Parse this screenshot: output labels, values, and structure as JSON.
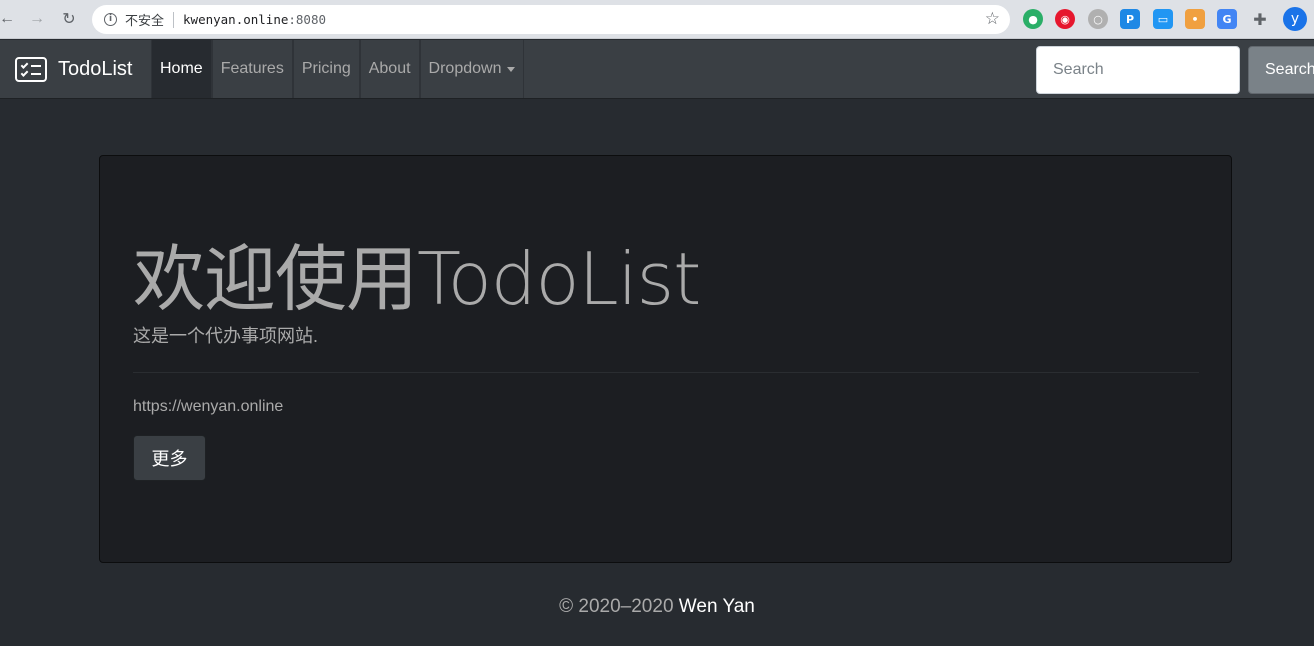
{
  "browser": {
    "back_icon": "arrow-left-icon",
    "forward_icon": "arrow-right-icon",
    "reload_icon": "reload-icon",
    "security_label": "不安全",
    "url_host": "kwenyan.online",
    "url_port": ":8080",
    "bookmark_icon": "star-icon",
    "avatar_letter": "y"
  },
  "navbar": {
    "brand": "TodoList",
    "items": [
      {
        "label": "Home",
        "active": true
      },
      {
        "label": "Features"
      },
      {
        "label": "Pricing"
      },
      {
        "label": "About"
      },
      {
        "label": "Dropdown"
      }
    ],
    "search_placeholder": "Search",
    "search_button": "Search"
  },
  "jumbotron": {
    "title": "欢迎使用TodoList",
    "lead": "这是一个代办事项网站.",
    "link": "https://wenyan.online",
    "button": "更多"
  },
  "footer": {
    "copyright": "© 2020–2020",
    "author": "Wen Yan"
  }
}
